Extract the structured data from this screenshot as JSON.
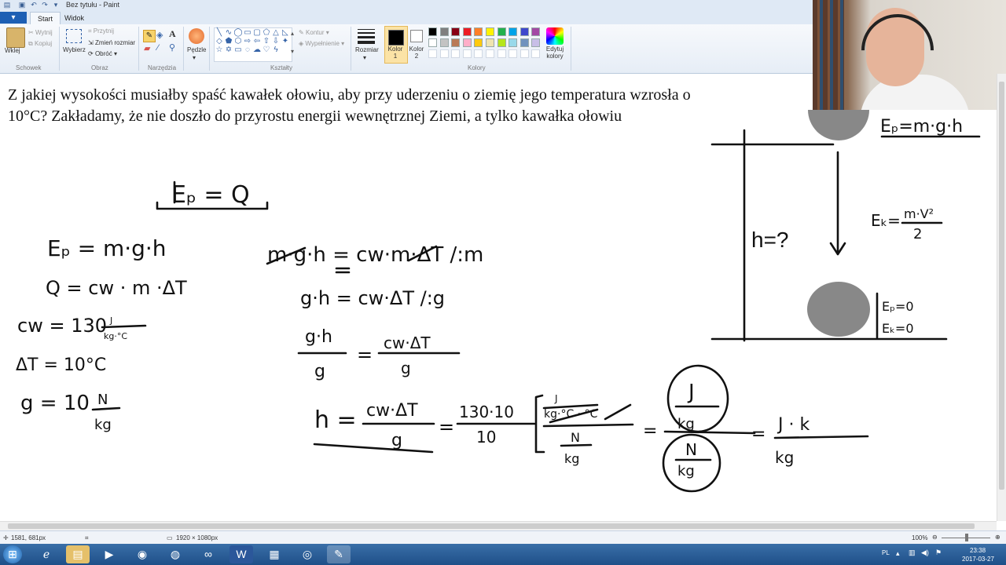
{
  "window": {
    "title": "Bez tytułu - Paint"
  },
  "tabs": {
    "file": "▾",
    "start": "Start",
    "view": "Widok"
  },
  "ribbon": {
    "clipboard": {
      "paste": "Wklej",
      "cut": "Wytnij",
      "copy": "Kopiuj",
      "label": "Schowek"
    },
    "image": {
      "select": "Wybierz",
      "crop": "Przytnij",
      "resize": "Zmień rozmiar",
      "rotate": "Obróć",
      "label": "Obraz"
    },
    "tools": {
      "label": "Narzędzia"
    },
    "brushes": {
      "label": "Pędzle"
    },
    "shapes": {
      "outline": "Kontur",
      "fill": "Wypełnienie",
      "label": "Kształty"
    },
    "size": {
      "label": "Rozmiar"
    },
    "colors": {
      "color1": "Kolor 1",
      "color2": "Kolor 2",
      "edit": "Edytuj kolory",
      "label": "Kolory",
      "color1_value": "#000000",
      "color2_value": "#ffffff",
      "palette_row1": [
        "#000000",
        "#7f7f7f",
        "#880015",
        "#ed1c24",
        "#ff7f27",
        "#fff200",
        "#22b14c",
        "#00a2e8",
        "#3f48cc",
        "#a349a4"
      ],
      "palette_row2": [
        "#ffffff",
        "#c3c3c3",
        "#b97a57",
        "#ffaec9",
        "#ffc90e",
        "#efe4b0",
        "#b5e61d",
        "#99d9ea",
        "#7092be",
        "#c8bfe7"
      ]
    }
  },
  "canvas": {
    "question": "Z jakiej wysokości musiałby spaść kawałek ołowiu, aby przy uderzeniu o ziemię jego temperatura wzrosła o 10°C? Zakładamy, że nie doszło do przyrostu energii wewnętrznej Ziemi, a tylko kawałka ołowiu",
    "height_label": "h=?"
  },
  "status": {
    "cursor": "1581, 681px",
    "canvas_size": "1920 × 1080px",
    "zoom": "100%"
  },
  "tray": {
    "lang": "PL",
    "time": "23:38",
    "date": "2017-03-27"
  }
}
